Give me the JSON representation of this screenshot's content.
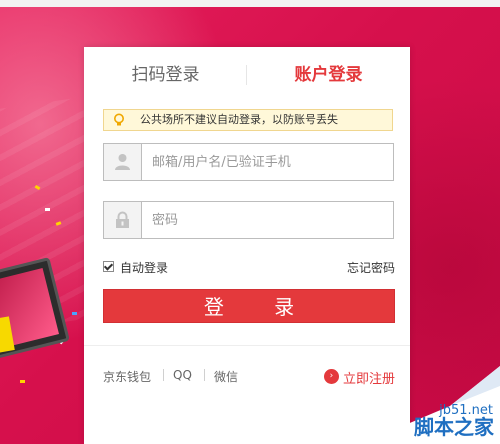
{
  "tabs": {
    "qr_login": "扫码登录",
    "account_login": "账户登录"
  },
  "notice": {
    "text": "公共场所不建议自动登录，以防账号丢失",
    "icon": "lightbulb-icon"
  },
  "username": {
    "placeholder": "邮箱/用户名/已验证手机",
    "value": "",
    "icon": "user-icon"
  },
  "password": {
    "placeholder": "密码",
    "value": "",
    "icon": "lock-icon"
  },
  "auto_login": {
    "label": "自动登录",
    "checked": true
  },
  "forgot_password": "忘记密码",
  "login_button": "登  录",
  "footer": {
    "links": [
      "京东钱包",
      "QQ",
      "微信"
    ],
    "register": "立即注册"
  },
  "watermark": {
    "url": "jb51.net",
    "name": "脚本之家"
  },
  "colors": {
    "accent": "#e4393c",
    "background": "#e01a5a",
    "notice_bg": "#fff8d9"
  }
}
